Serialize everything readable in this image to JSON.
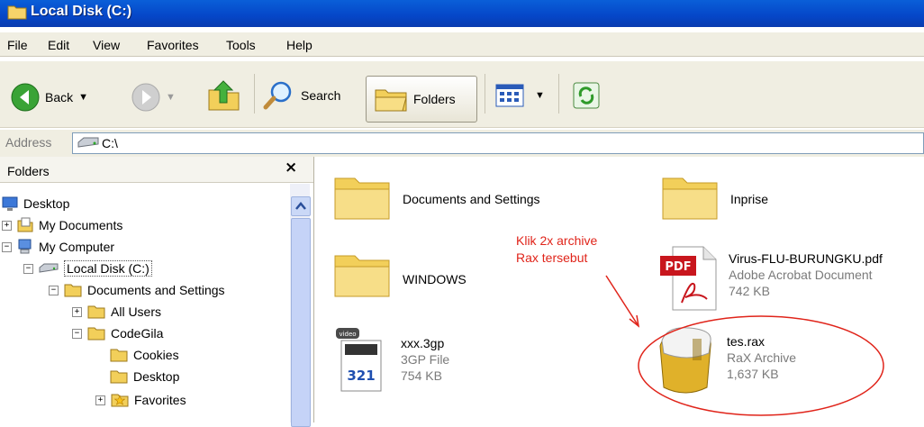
{
  "window": {
    "title": "Local Disk (C:)"
  },
  "menu": [
    "File",
    "Edit",
    "View",
    "Favorites",
    "Tools",
    "Help"
  ],
  "toolbar": {
    "back": "Back",
    "search": "Search",
    "folders": "Folders"
  },
  "address": {
    "label": "Address",
    "value": "C:\\"
  },
  "folders_pane": {
    "title": "Folders",
    "close": "×",
    "tree": [
      "Desktop",
      "My Documents",
      "My Computer",
      "Local Disk (C:)",
      "Documents and Settings",
      "All Users",
      "CodeGila",
      "Cookies",
      "Desktop",
      "Favorites"
    ]
  },
  "files": [
    {
      "name": "Documents and Settings"
    },
    {
      "name": "Inprise"
    },
    {
      "name": "WINDOWS"
    },
    {
      "name": "Virus-FLU-BURUNGKU.pdf",
      "type": "Adobe Acrobat Document",
      "size": "742 KB"
    },
    {
      "name": "xxx.3gp",
      "type": "3GP File",
      "size": "754 KB"
    },
    {
      "name": "tes.rax",
      "type": "RaX Archive",
      "size": "1,637 KB"
    }
  ],
  "annotation": {
    "line1": "Klik 2x archive",
    "line2": "Rax tersebut"
  },
  "colors": {
    "title_bar": "#0546c8",
    "annotation": "#e0241a",
    "folder": "#f2cf5a"
  }
}
